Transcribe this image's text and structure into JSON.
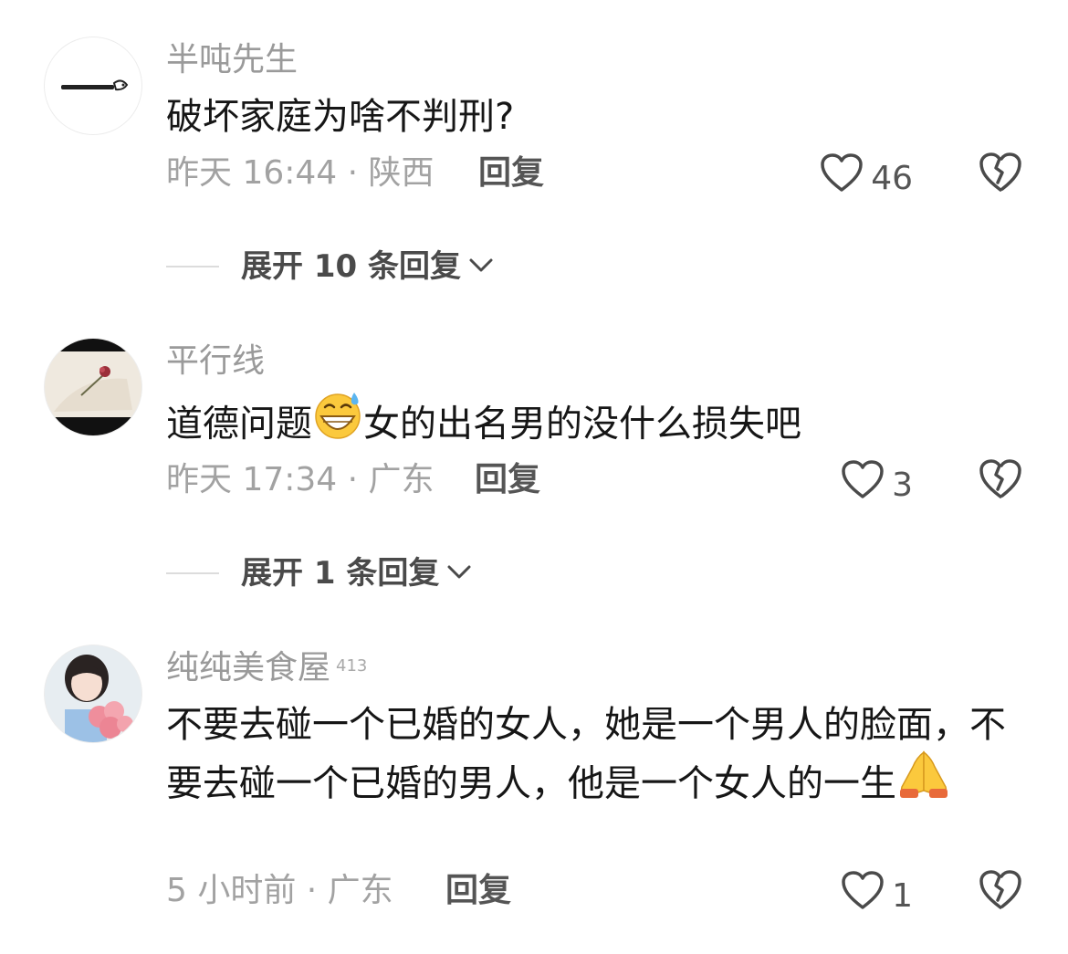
{
  "comments": [
    {
      "username": "半吨先生",
      "text": "破坏家庭为啥不判刑?",
      "meta": "昨天 16:44 · 陕西",
      "reply_label": "回复",
      "likes": "46",
      "expand_label": "展开 10 条回复"
    },
    {
      "username": "平行线",
      "text_before": "道德问题",
      "text_after": "女的出名男的没什么损失吧",
      "meta": "昨天 17:34 · 广东",
      "reply_label": "回复",
      "likes": "3",
      "expand_label": "展开 1 条回复"
    },
    {
      "username": "纯纯美食屋",
      "user_badge": "413",
      "text": "不要去碰一个已婚的女人，她是一个男人的脸面，不要去碰一个已婚的男人，他是一个女人的一生",
      "meta": "5 小时前 · 广东",
      "reply_label": "回复",
      "likes": "1"
    }
  ],
  "icons": {
    "like": "heart-outline-icon",
    "dislike": "broken-heart-icon",
    "expand": "chevron-down-icon",
    "emoji_1": "grinning-sweat-emoji",
    "emoji_2": "folded-hands-emoji"
  }
}
